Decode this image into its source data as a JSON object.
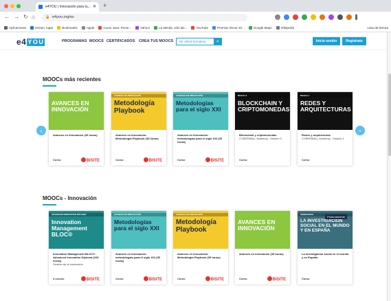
{
  "browser": {
    "tab_title": "e4YOU | Innovación para tu...",
    "url": "e4you.org/es",
    "bookmarks": [
      "Aplicaciones",
      "Dream, lugar",
      "Bookmarks",
      "Apple",
      "Curso Java: Prese...",
      "Yahoo!",
      "La alenda, sólo las...",
      "YouTube",
      "Premios Óscar 20...",
      "Google Maps",
      "Wikipedia"
    ],
    "bookmarks_right": "Lista de lectura",
    "colors": {
      "bar": "#dee1e6",
      "accent": "#1a73e8"
    }
  },
  "site": {
    "logo_main": "e4",
    "logo_you": "YOU",
    "nav": [
      "PROGRAMAS",
      "MOOCS",
      "CERTIFICADOS",
      "CREA TUS MOOCS"
    ],
    "search_placeholder": "Ver oferta formativa",
    "login": "Inicio sesión",
    "register": "Regístrate",
    "accent": "#1aa0d9"
  },
  "sections": [
    {
      "title": "MOOCs más recientes",
      "cards": [
        {
          "thumb_bar": "",
          "thumb_text": "AVANCES EN INNOVACIÓN",
          "thumb_bg": "#8dc63f",
          "thumb_fg": "#ffffff",
          "title": "Avances en Innovación (35 horas)",
          "sub": "",
          "type": "Curso",
          "badge": "BISITE"
        },
        {
          "thumb_bar": "AVANCES EN INNOVACIÓN",
          "thumb_text": "Metodología Playbook",
          "thumb_bg": "#f4c92b",
          "thumb_fg": "#1e2a4a",
          "title": "Avances en Innovación: Metodología Playbook (35 horas)",
          "sub": "",
          "type": "Curso",
          "badge": "BISITE"
        },
        {
          "thumb_bar": "AVANCES EN INNOVACIÓN",
          "thumb_text": "Metodologías para el siglo XXI",
          "thumb_bg": "#4dbfbf",
          "thumb_fg": "#1e2a4a",
          "title": "Avances en Innovación: metodologías para el siglo XXI (35 horas)",
          "sub": "",
          "type": "Curso",
          "badge": "BISITE"
        },
        {
          "thumb_bar": "Módulo 2",
          "thumb_text": "BLOCKCHAIN Y CRIPTOMONEDAS",
          "thumb_bg": "#111111",
          "thumb_fg": "#ffffff",
          "title": "Blockchain y criptomonedas",
          "sub": "CYBERWALL Academy - Módulo II",
          "type": "Curso",
          "badge": ""
        },
        {
          "thumb_bar": "Módulo 1",
          "thumb_text": "REDES Y ARQUITECTURAS",
          "thumb_bg": "#111111",
          "thumb_fg": "#ffffff",
          "title": "Redes y arquitecturas",
          "sub": "CYBERWALL Academy - Módulo 1",
          "type": "Curso",
          "badge": ""
        }
      ]
    },
    {
      "title": "MOOCs - Innovación",
      "cards": [
        {
          "thumb_bar": "ADVANCED INNOVATION DIPLOMA",
          "thumb_text": "Innovation Management BLOC®",
          "thumb_bg": "#1e8a8a",
          "thumb_fg": "#ffffff",
          "title": "Innovation Management BLOC® - Advanced Innovation Diploma (105 horas)",
          "sub": "Gestión de la innovación",
          "type": "3 cursos",
          "badge": "BISITE"
        },
        {
          "thumb_bar": "AVANCES EN INNOVACIÓN",
          "thumb_text": "Metodologías para el siglo XXI",
          "thumb_bg": "#4dbfbf",
          "thumb_fg": "#1e2a4a",
          "title": "Avances en Innovación: metodologías para el siglo XXI (35 horas)",
          "sub": "",
          "type": "Curso",
          "badge": "BISITE"
        },
        {
          "thumb_bar": "AVANCES EN INNOVACIÓN",
          "thumb_text": "Metodología Playbook",
          "thumb_bg": "#f4c92b",
          "thumb_fg": "#1e2a4a",
          "title": "Avances en Innovación: Metodología Playbook (35 horas)",
          "sub": "",
          "type": "Curso",
          "badge": "BISITE"
        },
        {
          "thumb_bar": "",
          "thumb_text": "AVANCES EN INNOVACIÓN",
          "thumb_bg": "#8dc63f",
          "thumb_fg": "#ffffff",
          "title": "Avances en Innovación (35 horas)",
          "sub": "",
          "type": "Curso",
          "badge": "BISITE"
        },
        {
          "thumb_bar": "SEMINARIOS",
          "thumb_text": "LA INVESTIGACIÓN SOCIAL EN EL MUNDO Y EN ESPAÑA",
          "thumb_bg": "#3a6f7d",
          "thumb_fg": "#ffffff",
          "title": "La investigación social en el mundo y en España",
          "sub": "",
          "type": "Curso",
          "badge": "",
          "ribbon": "Próximamente"
        }
      ]
    }
  ]
}
